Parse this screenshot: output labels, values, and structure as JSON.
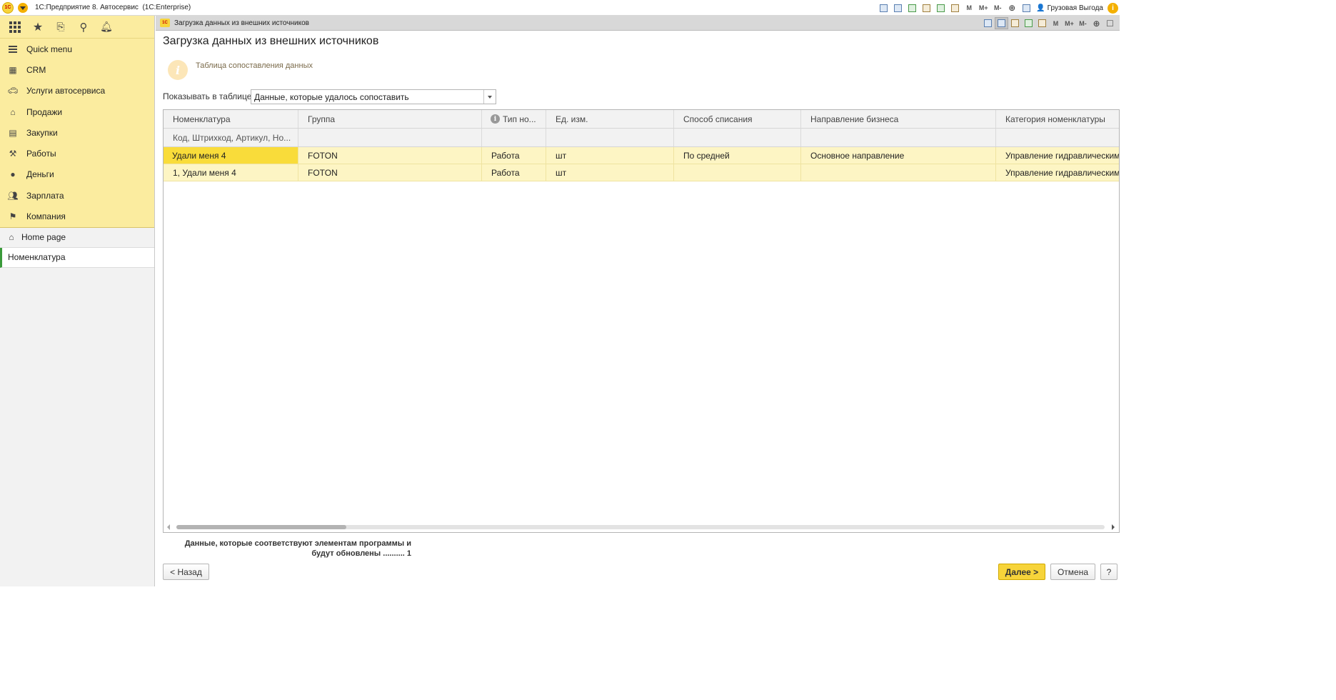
{
  "window": {
    "logo_text": "1С",
    "app_title": "1С:Предприятие 8. Автосервис  (1С:Enterprise)",
    "toolbar_m": "M",
    "toolbar_mplus": "M+",
    "toolbar_mminus": "M-",
    "user_name": "Грузовая Выгода",
    "info_glyph": "i"
  },
  "sidebar": {
    "sections": [
      {
        "label": "Quick menu",
        "icon": "hamburger-icon"
      },
      {
        "label": "CRM",
        "icon": "crm-icon"
      },
      {
        "label": "Услуги автосервиса",
        "icon": "car-icon"
      },
      {
        "label": "Продажи",
        "icon": "shop-icon"
      },
      {
        "label": "Закупки",
        "icon": "purchase-icon"
      },
      {
        "label": "Работы",
        "icon": "tools-icon"
      },
      {
        "label": "Деньги",
        "icon": "money-icon"
      },
      {
        "label": "Зарплата",
        "icon": "people-icon"
      },
      {
        "label": "Компания",
        "icon": "flag-icon"
      }
    ],
    "home_label": "Home page",
    "open_window_label": "Номенклатура"
  },
  "tab": {
    "logo_text": "1С",
    "title": "Загрузка данных из внешних источников"
  },
  "form": {
    "title": "Загрузка данных из внешних источников",
    "info_glyph": "i",
    "info_text": "Таблица сопоставления данных",
    "filter_label": "Показывать в таблице:",
    "filter_value": "Данные, которые удалось сопоставить"
  },
  "table": {
    "columns": [
      "Номенклатура",
      "Группа",
      "Тип но...",
      "Ед. изм.",
      "Способ списания",
      "Направление бизнеса",
      "Категория номенклатуры"
    ],
    "filter_row": [
      "Код, Штрихкод, Артикул, Но...",
      "",
      "",
      "",
      "",
      "",
      ""
    ],
    "rows": [
      [
        "Удали меня 4",
        "FOTON",
        "Работа",
        "шт",
        "По средней",
        "Основное направление",
        "Управление гидравлическим м"
      ],
      [
        "1, Удали меня 4",
        "FOTON",
        "Работа",
        "шт",
        "",
        "",
        "Управление гидравлическим м"
      ]
    ]
  },
  "summary": {
    "line1": "Данные, которые соответствуют элементам программы и",
    "line2": "будут обновлены .......... 1"
  },
  "buttons": {
    "back": "< Назад",
    "next": "Далее >",
    "cancel": "Отмена",
    "help": "?"
  },
  "colors": {
    "sidebar_accent": "#fbec9f",
    "selected_cell": "#f9dc3a",
    "row_highlight": "#fdf5c4",
    "primary_button": "#f7d43a"
  }
}
